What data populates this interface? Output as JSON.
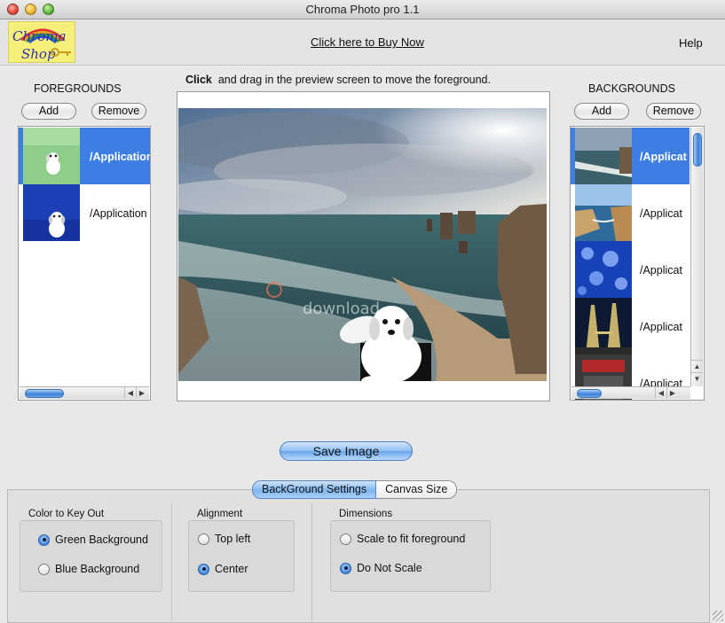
{
  "window": {
    "title": "Chroma Photo pro 1.1"
  },
  "header": {
    "logo_text_line1": "Chroma",
    "logo_text_line2": "Shop",
    "buy_link": "Click here to Buy Now",
    "help": "Help"
  },
  "instructions": {
    "bold": "Click",
    "rest": "and drag in the preview screen to move the foreground."
  },
  "foregrounds": {
    "title": "FOREGROUNDS",
    "add_label": "Add",
    "remove_label": "Remove",
    "items": [
      {
        "path": "/Application",
        "thumb": "green-background-dog",
        "selected": true
      },
      {
        "path": "/Application",
        "thumb": "blue-background-dog",
        "selected": false
      }
    ]
  },
  "backgrounds": {
    "title": "BACKGROUNDS",
    "add_label": "Add",
    "remove_label": "Remove",
    "items": [
      {
        "path": "/Applicat",
        "thumb": "coast-waves",
        "selected": true
      },
      {
        "path": "/Applicat",
        "thumb": "coastal-cliffs",
        "selected": false
      },
      {
        "path": "/Applicat",
        "thumb": "jellyfish",
        "selected": false
      },
      {
        "path": "/Applicat",
        "thumb": "twin-towers-night",
        "selected": false
      },
      {
        "path": "/Applicat",
        "thumb": "dark-sign",
        "selected": false
      }
    ]
  },
  "preview": {
    "watermark": "download"
  },
  "save_button": "Save Image",
  "tabs": [
    {
      "label": "BackGround Settings",
      "active": true
    },
    {
      "label": "Canvas Size",
      "active": false
    }
  ],
  "settings": {
    "color_key": {
      "title": "Color to Key Out",
      "options": [
        {
          "label": "Green Background",
          "checked": true
        },
        {
          "label": "Blue Background",
          "checked": false
        }
      ]
    },
    "alignment": {
      "title": "Alignment",
      "options": [
        {
          "label": "Top left",
          "checked": false
        },
        {
          "label": "Center",
          "checked": true
        }
      ]
    },
    "dimensions": {
      "title": "Dimensions",
      "options": [
        {
          "label": "Scale to fit foreground",
          "checked": false
        },
        {
          "label": "Do Not Scale",
          "checked": true
        }
      ]
    }
  },
  "colors": {
    "selection": "#3d7ee2",
    "aqua_button": "#7fb6ef",
    "logo_background": "#f4f07a"
  }
}
